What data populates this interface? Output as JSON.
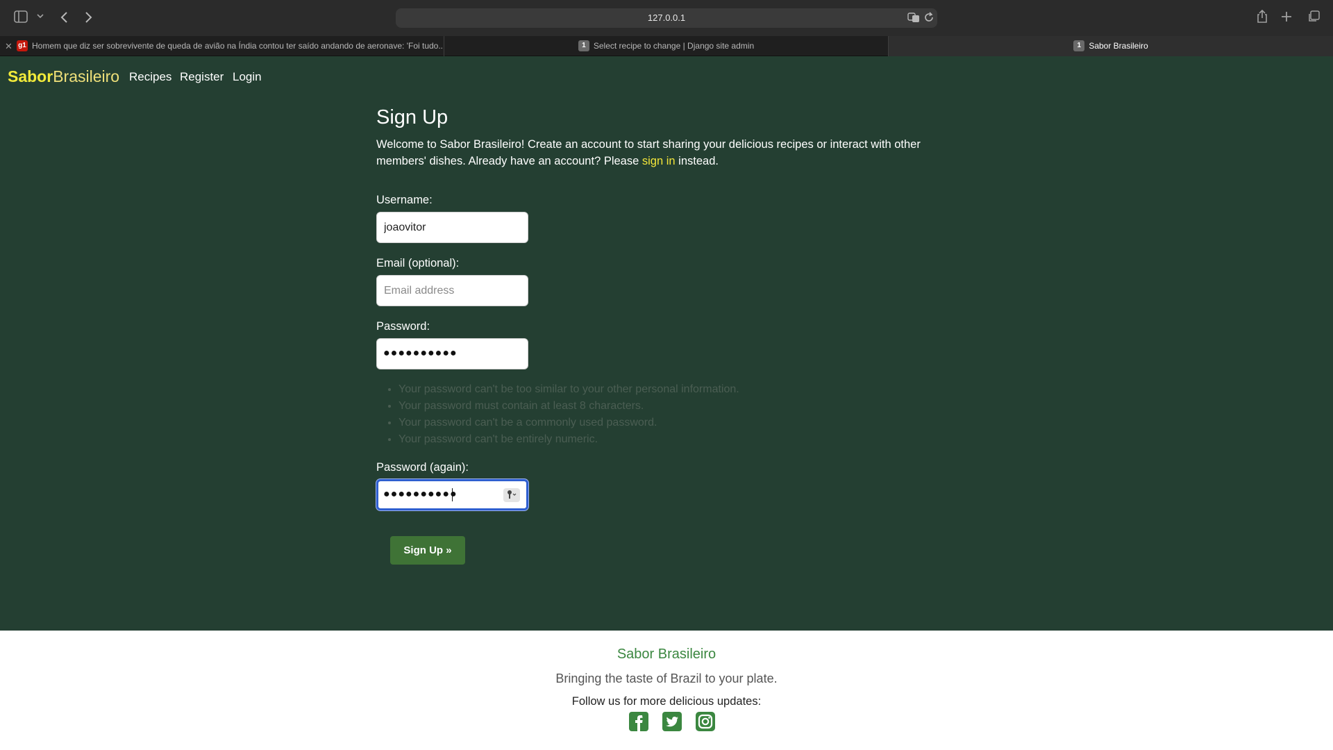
{
  "browser": {
    "url": "127.0.0.1",
    "tabs": [
      {
        "title": "Homem que diz ser sobrevivente de queda de avião na Índia contou ter saído andando de aeronave: 'Foi tudo...",
        "favicon": "g1",
        "favicon_color": "#c4170c"
      },
      {
        "title": "Select recipe to change | Django site admin",
        "favicon": "1",
        "favicon_color": "#6a6a6a"
      },
      {
        "title": "Sabor Brasileiro",
        "favicon": "1",
        "favicon_color": "#6a6a6a"
      }
    ]
  },
  "nav": {
    "brand_bold": "Sabor",
    "brand_light": "Brasileiro",
    "links": [
      "Recipes",
      "Register",
      "Login"
    ]
  },
  "signup": {
    "title": "Sign Up",
    "intro_before": "Welcome to Sabor Brasileiro! Create an account to start sharing your delicious recipes or interact with other members' dishes. Already have an account? Please ",
    "intro_link": "sign in",
    "intro_after": " instead.",
    "username_label": "Username:",
    "username_value": "joaovitor",
    "email_label": "Email (optional):",
    "email_placeholder": "Email address",
    "password_label": "Password:",
    "password_masked": "●●●●●●●●●●",
    "password_help": [
      "Your password can't be too similar to your other personal information.",
      "Your password must contain at least 8 characters.",
      "Your password can't be a commonly used password.",
      "Your password can't be entirely numeric."
    ],
    "password2_label": "Password (again):",
    "password2_masked": "●●●●●●●●●●",
    "submit_label": "Sign Up »"
  },
  "footer": {
    "title": "Sabor Brasileiro",
    "tagline": "Bringing the taste of Brazil to your plate.",
    "follow": "Follow us for more delicious updates:",
    "social_icons": [
      "facebook-icon",
      "twitter-icon",
      "instagram-icon"
    ]
  },
  "colors": {
    "page_bg": "#243f32",
    "brand_yellow": "#f2ea3a",
    "button_green": "#3f7336",
    "footer_green": "#3b8740"
  }
}
